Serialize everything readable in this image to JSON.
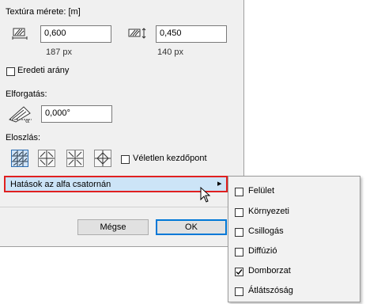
{
  "texture": {
    "section_label": "Textúra mérete: [m]",
    "width_value": "0,600",
    "height_value": "0,450",
    "width_px": "187 px",
    "height_px": "140 px",
    "keep_ratio_label": "Eredeti arány",
    "keep_ratio_checked": false
  },
  "rotation": {
    "label": "Elforgatás:",
    "value": "0,000°"
  },
  "distribution": {
    "label": "Eloszlás:",
    "random_start_label": "Véletlen kezdőpont",
    "random_start_checked": false
  },
  "alpha_menu": {
    "label": "Hatások az alfa csatornán",
    "arrow": "▸"
  },
  "buttons": {
    "cancel_label": "Mégse",
    "ok_label": "OK"
  },
  "submenu": {
    "items": [
      {
        "label": "Felület",
        "checked": false
      },
      {
        "label": "Környezeti",
        "checked": false
      },
      {
        "label": "Csillogás",
        "checked": false
      },
      {
        "label": "Diffúzió",
        "checked": false
      },
      {
        "label": "Domborzat",
        "checked": true
      },
      {
        "label": "Átlátszóság",
        "checked": false
      }
    ]
  },
  "colors": {
    "highlight_bg": "#cce4f7",
    "highlight_border": "#e02020",
    "accent": "#0078d7"
  }
}
